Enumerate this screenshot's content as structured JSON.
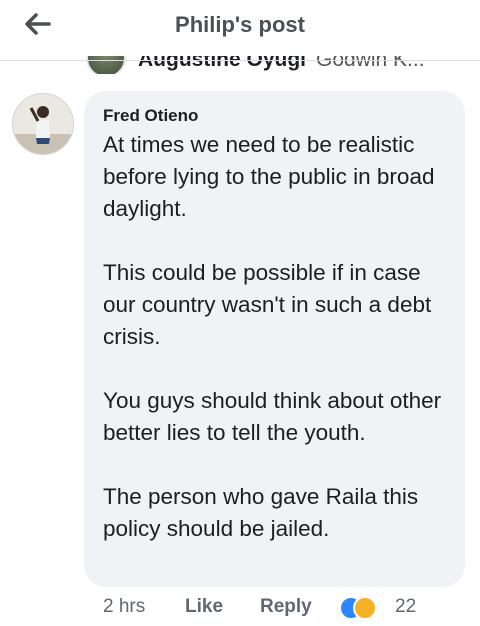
{
  "header": {
    "title": "Philip's post",
    "back_icon": "arrow-left-icon"
  },
  "previous_reply": {
    "author": "Augustine Oyugi",
    "tagged": "Godwin K..."
  },
  "comment": {
    "author": "Fred Otieno",
    "paragraphs": [
      "At times we need to be realistic before lying to the public in broad daylight.",
      "This could be possible if in case our country wasn't in such a debt crisis.",
      "You guys should think about other better lies to tell the youth.",
      "The person who gave Raila this policy should be jailed."
    ]
  },
  "actions": {
    "time": "2 hrs",
    "like_label": "Like",
    "reply_label": "Reply",
    "reaction_count": "22",
    "reaction_icons": [
      "like-reaction-icon",
      "haha-reaction-icon"
    ]
  },
  "colors": {
    "bubble_bg": "#f0f2f5",
    "header_title": "#4b4f56",
    "meta_text": "#606770",
    "like_blue": "#2d88ff",
    "haha_yellow": "#f7b125"
  }
}
